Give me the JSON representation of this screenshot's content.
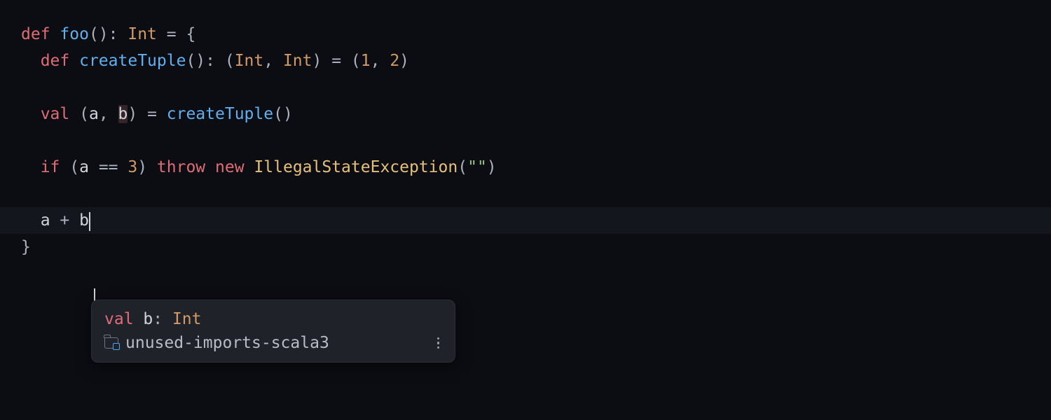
{
  "code": {
    "line1": {
      "def": "def",
      "fn": "foo",
      "parens": "()",
      "colon": ": ",
      "retType": "Int",
      "eq": " = {"
    },
    "line2": {
      "indent": "  ",
      "def": "def",
      "fn": "createTuple",
      "parens": "()",
      "colon": ": ",
      "lp": "(",
      "t1": "Int",
      "comma": ", ",
      "t2": "Int",
      "rp": ")",
      "eq": " = (",
      "n1": "1",
      "c2": ", ",
      "n2": "2",
      "rp2": ")"
    },
    "line3": {
      "indent": "  ",
      "val": "val",
      "sp": " (",
      "a": "a",
      "comma": ", ",
      "b": "b",
      "rp": ") = ",
      "fn": "createTuple",
      "parens": "()"
    },
    "line4": {
      "indent": "  ",
      "if": "if",
      "lp": " (",
      "a": "a",
      "eqop": " == ",
      "three": "3",
      "rp": ") ",
      "throw": "throw",
      "sp": " ",
      "new": "new",
      "sp2": " ",
      "cls": "IllegalStateException",
      "lp2": "(",
      "str": "\"\"",
      "rp2": ")"
    },
    "line5": {
      "indent": "  ",
      "a": "a",
      "plus": " + ",
      "b": "b"
    },
    "line6": {
      "brace": "}"
    }
  },
  "tooltip": {
    "kw": "val",
    "ident": " b",
    "colon": ": ",
    "type": "Int",
    "source": "unused-imports-scala3"
  }
}
